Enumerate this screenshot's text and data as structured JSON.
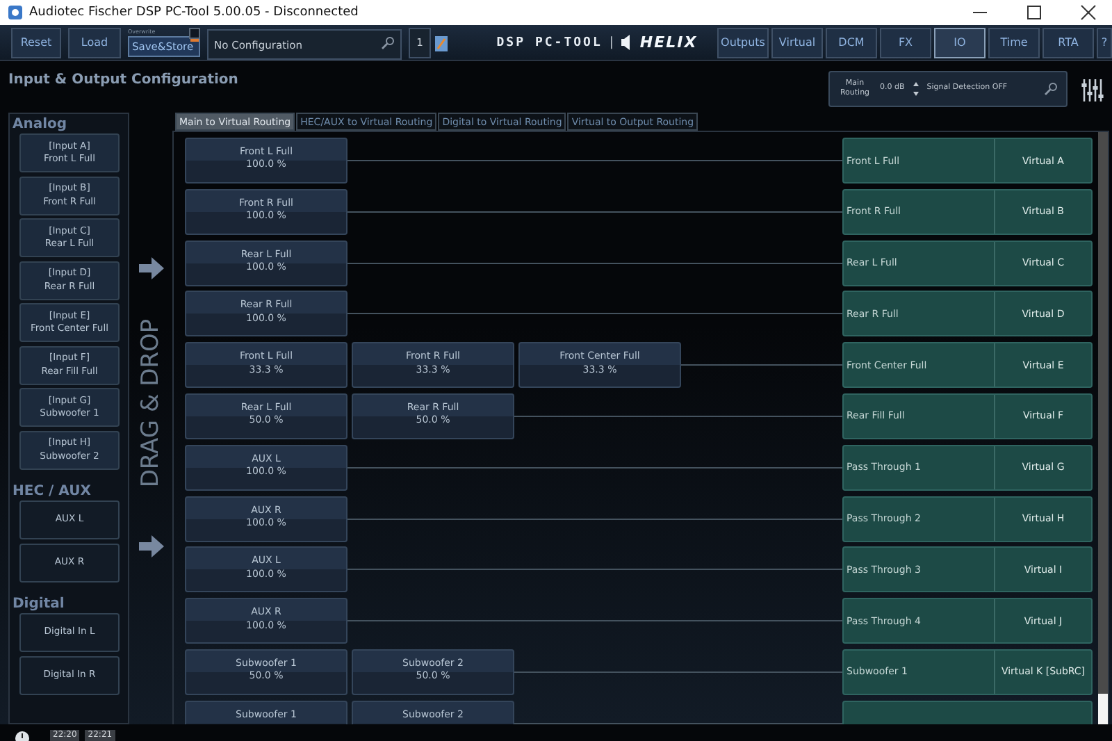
{
  "window": {
    "title": "Audiotec Fischer DSP PC-Tool 5.00.05 - Disconnected"
  },
  "toolbar": {
    "buttons": [
      {
        "label": "Reset"
      },
      {
        "label": "Load"
      }
    ],
    "save": {
      "caption": "Overwrite",
      "label": "Save&Store",
      "overwrite_checked": false
    },
    "configuration": {
      "value": "No Configuration"
    },
    "preset_number": "1",
    "logo": {
      "text": "DSP PC-TOOL",
      "separator": "|",
      "brand": "HELIX"
    },
    "nav": [
      {
        "label": "Outputs",
        "selected": false
      },
      {
        "label": "Virtual",
        "selected": false
      },
      {
        "label": "DCM",
        "selected": false
      },
      {
        "label": "FX",
        "selected": false
      },
      {
        "label": "IO",
        "selected": true
      },
      {
        "label": "Time",
        "selected": false
      },
      {
        "label": "RTA",
        "selected": false
      },
      {
        "label": "?",
        "selected": false
      }
    ]
  },
  "page_title": "Input & Output Configuration",
  "routing_control": {
    "label": "Main Routing",
    "gain": "0.0 dB",
    "signal_detection": "Signal Detection OFF"
  },
  "input_groups": [
    {
      "title": "Analog",
      "inputs": [
        {
          "lines": [
            "[Input A]",
            "Front L Full"
          ]
        },
        {
          "lines": [
            "[Input B]",
            "Front R Full"
          ]
        },
        {
          "lines": [
            "[Input C]",
            "Rear L Full"
          ]
        },
        {
          "lines": [
            "[Input D]",
            "Rear R Full"
          ]
        },
        {
          "lines": [
            "[Input E]",
            "Front Center Full"
          ]
        },
        {
          "lines": [
            "[Input F]",
            "Rear Fill Full"
          ]
        },
        {
          "lines": [
            "[Input G]",
            "Subwoofer 1"
          ]
        },
        {
          "lines": [
            "[Input H]",
            "Subwoofer 2"
          ]
        }
      ]
    },
    {
      "title": "HEC / AUX",
      "inputs": [
        {
          "lines": [
            "AUX L"
          ]
        },
        {
          "lines": [
            "AUX R"
          ]
        }
      ]
    },
    {
      "title": "Digital",
      "inputs": [
        {
          "lines": [
            "Digital In L"
          ]
        },
        {
          "lines": [
            "Digital In R"
          ]
        }
      ]
    }
  ],
  "drag_hint": "DRAG & DROP",
  "tabs": [
    {
      "label": "Main to Virtual Routing",
      "selected": true
    },
    {
      "label": "HEC/AUX to Virtual Routing",
      "selected": false
    },
    {
      "label": "Digital to Virtual Routing",
      "selected": false
    },
    {
      "label": "Virtual to Output Routing",
      "selected": false
    }
  ],
  "routes": [
    {
      "sources": [
        {
          "name": "Front L Full",
          "share": "100.0 %"
        }
      ],
      "output": {
        "name": "Front L Full",
        "virtual": "Virtual A"
      }
    },
    {
      "sources": [
        {
          "name": "Front R Full",
          "share": "100.0 %"
        }
      ],
      "output": {
        "name": "Front R Full",
        "virtual": "Virtual B"
      }
    },
    {
      "sources": [
        {
          "name": "Rear L Full",
          "share": "100.0 %"
        }
      ],
      "output": {
        "name": "Rear L Full",
        "virtual": "Virtual C"
      }
    },
    {
      "sources": [
        {
          "name": "Rear R Full",
          "share": "100.0 %"
        }
      ],
      "output": {
        "name": "Rear R Full",
        "virtual": "Virtual D"
      }
    },
    {
      "sources": [
        {
          "name": "Front L Full",
          "share": "33.3 %"
        },
        {
          "name": "Front R Full",
          "share": "33.3 %"
        },
        {
          "name": "Front Center Full",
          "share": "33.3 %"
        }
      ],
      "output": {
        "name": "Front Center Full",
        "virtual": "Virtual E"
      }
    },
    {
      "sources": [
        {
          "name": "Rear L Full",
          "share": "50.0 %"
        },
        {
          "name": "Rear R Full",
          "share": "50.0 %"
        }
      ],
      "output": {
        "name": "Rear Fill Full",
        "virtual": "Virtual F"
      }
    },
    {
      "sources": [
        {
          "name": "AUX L",
          "share": "100.0 %"
        }
      ],
      "output": {
        "name": "Pass Through 1",
        "virtual": "Virtual G"
      }
    },
    {
      "sources": [
        {
          "name": "AUX R",
          "share": "100.0 %"
        }
      ],
      "output": {
        "name": "Pass Through 2",
        "virtual": "Virtual H"
      }
    },
    {
      "sources": [
        {
          "name": "AUX L",
          "share": "100.0 %"
        }
      ],
      "output": {
        "name": "Pass Through 3",
        "virtual": "Virtual I"
      }
    },
    {
      "sources": [
        {
          "name": "AUX R",
          "share": "100.0 %"
        }
      ],
      "output": {
        "name": "Pass Through 4",
        "virtual": "Virtual J"
      }
    },
    {
      "sources": [
        {
          "name": "Subwoofer 1",
          "share": "50.0 %"
        },
        {
          "name": "Subwoofer 2",
          "share": "50.0 %"
        }
      ],
      "output": {
        "name": "Subwoofer 1",
        "virtual": "Virtual K [SubRC]"
      }
    },
    {
      "sources": [
        {
          "name": "Subwoofer 1"
        },
        {
          "name": "Subwoofer 2"
        }
      ]
    }
  ],
  "status_bar": {
    "times": [
      "22:20",
      "22:21"
    ]
  }
}
